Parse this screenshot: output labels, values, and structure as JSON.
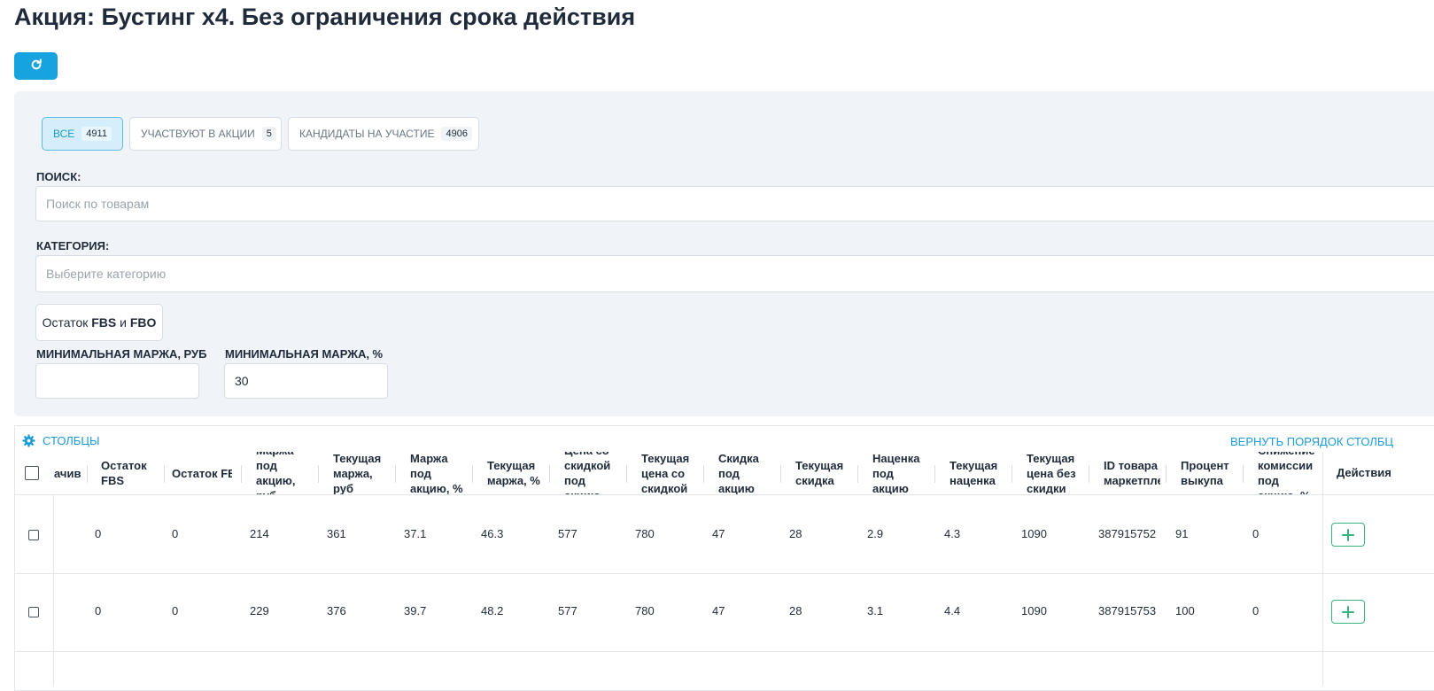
{
  "page": {
    "title": "Акция: Бустинг x4. Без ограничения срока действия"
  },
  "toolbar": {
    "refresh_icon": "refresh-icon"
  },
  "tabs": [
    {
      "label": "ВСЕ",
      "count": "4911",
      "active": true
    },
    {
      "label": "УЧАСТВУЮТ В АКЦИИ",
      "count": "5",
      "active": false
    },
    {
      "label": "КАНДИДАТЫ НА УЧАСТИЕ",
      "count": "4906",
      "active": false
    }
  ],
  "search": {
    "label": "ПОИСК:",
    "placeholder": "Поиск по товарам"
  },
  "category": {
    "label": "КАТЕГОРИЯ:",
    "placeholder": "Выберите категорию"
  },
  "stock_button": {
    "prefix": "Остаток ",
    "fbs": "FBS",
    "and": " и ",
    "fbo": "FBO"
  },
  "min_margin_rub": {
    "label": "МИНИМАЛЬНАЯ МАРЖА, РУБ",
    "value": ""
  },
  "min_margin_pct": {
    "label": "МИНИМАЛЬНАЯ МАРЖА, %",
    "value": "30"
  },
  "table": {
    "columns_link": "СТОЛБЦЫ",
    "restore_link": "ВЕРНУТЬ ПОРЯДОК СТОЛБЦ",
    "actions_header": "Действия",
    "headers": [
      "ачив",
      "Остаток FBS",
      "Остаток FB",
      "Маржа под акцию, руб",
      "Текущая маржа, руб",
      "Маржа под акцию, %",
      "Текущая маржа, %",
      "Цена со скидкой под акцию",
      "Текущая цена со скидкой",
      "Скидка под акцию",
      "Текущая скидка",
      "Наценка под акцию",
      "Текущая наценка",
      "Текущая цена без скидки",
      "ID товара маркетпле",
      "Процент выкупа",
      "Снижение комиссии под акцию, %"
    ],
    "rows": [
      [
        "",
        "0",
        "0",
        "214",
        "361",
        "37.1",
        "46.3",
        "577",
        "780",
        "47",
        "28",
        "2.9",
        "4.3",
        "1090",
        "387915752",
        "91",
        "0"
      ],
      [
        "",
        "0",
        "0",
        "229",
        "376",
        "39.7",
        "48.2",
        "577",
        "780",
        "47",
        "28",
        "3.1",
        "4.4",
        "1090",
        "387915753",
        "100",
        "0"
      ]
    ]
  },
  "colors": {
    "accent": "#17a2e0",
    "link": "#1b9bd6",
    "add": "#36b37e"
  }
}
